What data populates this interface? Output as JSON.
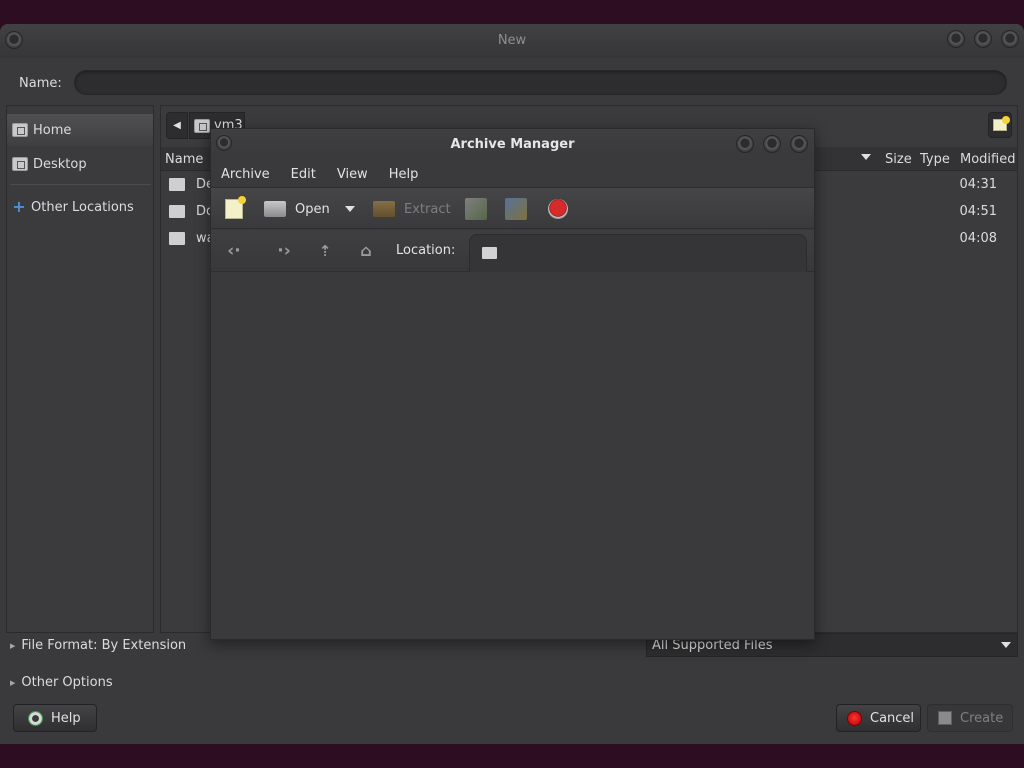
{
  "dialog": {
    "title": "New",
    "name_label": "Name:",
    "name_value": ""
  },
  "sidebar": {
    "items": [
      {
        "label": "Home",
        "icon": "home-folder-icon"
      },
      {
        "label": "Desktop",
        "icon": "desktop-folder-icon"
      },
      {
        "label": "Other Locations",
        "icon": "plus-icon"
      }
    ]
  },
  "pathbar": {
    "current": "vm3"
  },
  "file_list": {
    "columns": [
      "Name",
      "Size",
      "Type",
      "Modified"
    ],
    "rows": [
      {
        "name": "De",
        "modified": "04:31"
      },
      {
        "name": "Do",
        "modified": "04:51"
      },
      {
        "name": "wa",
        "modified": "04:08"
      }
    ]
  },
  "options": {
    "file_format": "File Format: By Extension",
    "other_options": "Other Options",
    "filter": "All Supported Files"
  },
  "buttons": {
    "help": "Help",
    "cancel": "Cancel",
    "create": "Create"
  },
  "archive_manager": {
    "title": "Archive Manager",
    "menus": [
      "Archive",
      "Edit",
      "View",
      "Help"
    ],
    "toolbar": {
      "open": "Open",
      "extract": "Extract"
    },
    "location_label": "Location:",
    "location_value": ""
  }
}
